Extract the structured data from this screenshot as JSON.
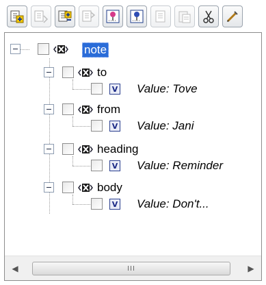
{
  "toolbar": {
    "buttons": [
      {
        "icon": "add-child-element-icon",
        "enabled": true
      },
      {
        "icon": "add-attribute-icon",
        "enabled": false
      },
      {
        "icon": "insert-element-icon",
        "enabled": true
      },
      {
        "icon": "insert-attribute-icon",
        "enabled": false
      },
      {
        "icon": "add-text-value-icon",
        "enabled": true
      },
      {
        "icon": "add-cdata-icon",
        "enabled": true
      },
      {
        "icon": "copy-icon",
        "enabled": false
      },
      {
        "icon": "paste-icon",
        "enabled": false
      },
      {
        "icon": "cut-icon",
        "enabled": true
      },
      {
        "icon": "clear-icon",
        "enabled": true
      }
    ]
  },
  "tree": {
    "root": {
      "label": "note",
      "selected": true
    },
    "children": [
      {
        "label": "to",
        "value": "Value: Tove"
      },
      {
        "label": "from",
        "value": "Value: Jani"
      },
      {
        "label": "heading",
        "value": "Value: Reminder"
      },
      {
        "label": "body",
        "value": "Value: Don't..."
      }
    ]
  },
  "scrollbar": {
    "left_arrow": "◀",
    "right_arrow": "▶",
    "grip": "III"
  },
  "colors": {
    "selection": "#2a6cd8",
    "value_icon": "#2b3f8f"
  }
}
